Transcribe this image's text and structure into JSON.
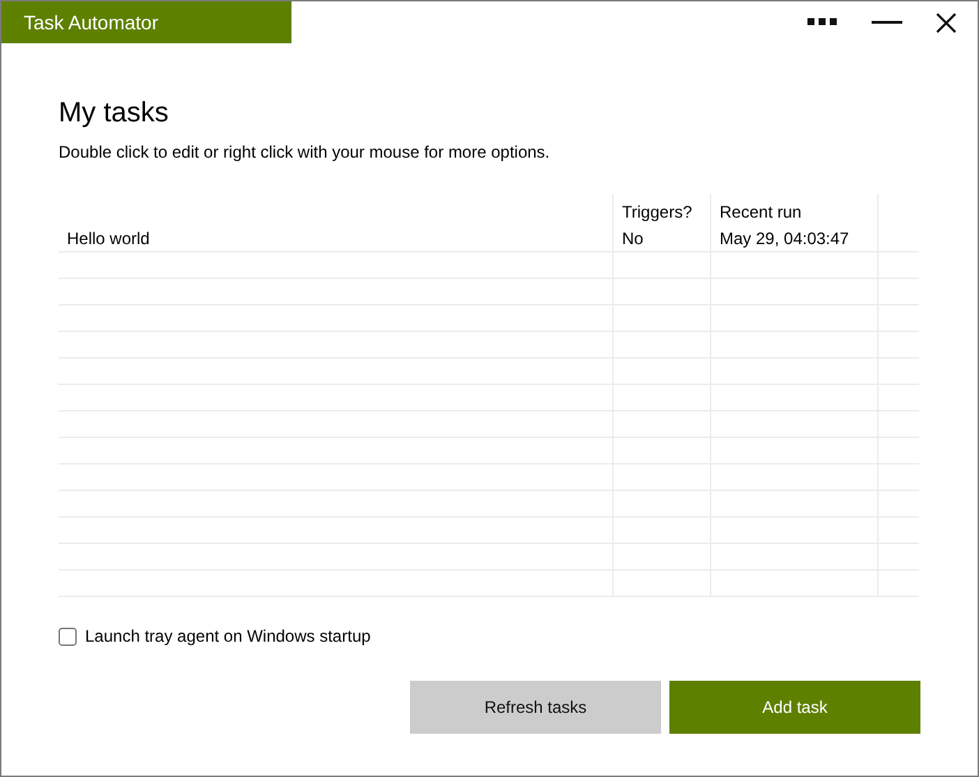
{
  "window": {
    "title": "Task Automator"
  },
  "heading": "My tasks",
  "hint": "Double click to edit or right click with your mouse for more options.",
  "table": {
    "columns": [
      "",
      "Triggers?",
      "Recent run"
    ],
    "rows": [
      {
        "cells": [
          "Hello world",
          "No",
          "May 29, 04:03:47"
        ],
        "selected": false
      }
    ]
  },
  "startup_option": {
    "label": "Launch tray agent on Windows startup",
    "checked": false
  },
  "buttons": [
    {
      "label": "Refresh tasks",
      "kind": "secondary"
    },
    {
      "label": "Add task",
      "kind": "primary"
    }
  ]
}
